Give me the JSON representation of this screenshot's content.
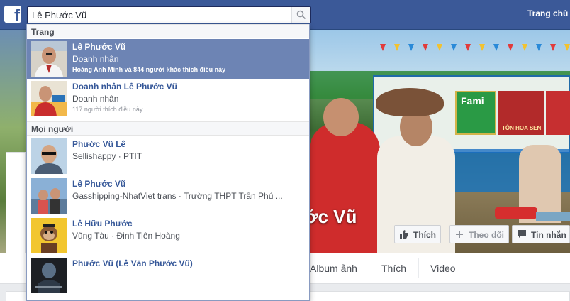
{
  "topbar": {
    "logo": "f",
    "search_value": "Lê Phước Vũ",
    "home_link": "Trang chủ"
  },
  "cover": {
    "profile_name": "ớc Vũ",
    "sign_fami": "Fami",
    "sign_tonhoasen": "TÔN HOA SEN",
    "buttons": {
      "like": "Thích",
      "follow": "Theo dõi",
      "message": "Tin nhắn"
    }
  },
  "profile_nav": {
    "items": [
      "Album ảnh",
      "Thích",
      "Video"
    ]
  },
  "dropdown": {
    "sections": {
      "pages": "Trang",
      "people": "Mọi người"
    },
    "pages": [
      {
        "name": "Lê Phước Vũ",
        "subtitle": "Doanh nhân",
        "meta": "Hoàng Anh Minh và 844 người khác thích điều này",
        "active": true
      },
      {
        "name": "Doanh nhân Lê Phước Vũ",
        "subtitle": "Doanh nhân",
        "meta": "117 người thích điều này.",
        "active": false
      }
    ],
    "people": [
      {
        "name": "Phước Vũ Lê",
        "subtitle": "Sellishappy · PTIT"
      },
      {
        "name": "Lê Phước Vũ",
        "subtitle": "Gasshipping-NhatViet trans · Trường THPT Trần Phú ..."
      },
      {
        "name": "Lê Hữu Phước",
        "subtitle": "Vũng Tàu · Đinh Tiên Hoàng"
      },
      {
        "name": "Phước Vũ (Lê Văn Phước Vũ)",
        "subtitle": ""
      }
    ]
  },
  "colors": {
    "topbar": "#3b5998",
    "active_result": "#6d84b4",
    "link": "#365899"
  },
  "icons": [
    "facebook-logo-icon",
    "search-icon",
    "thumbs-up-icon",
    "plus-icon",
    "message-icon"
  ]
}
